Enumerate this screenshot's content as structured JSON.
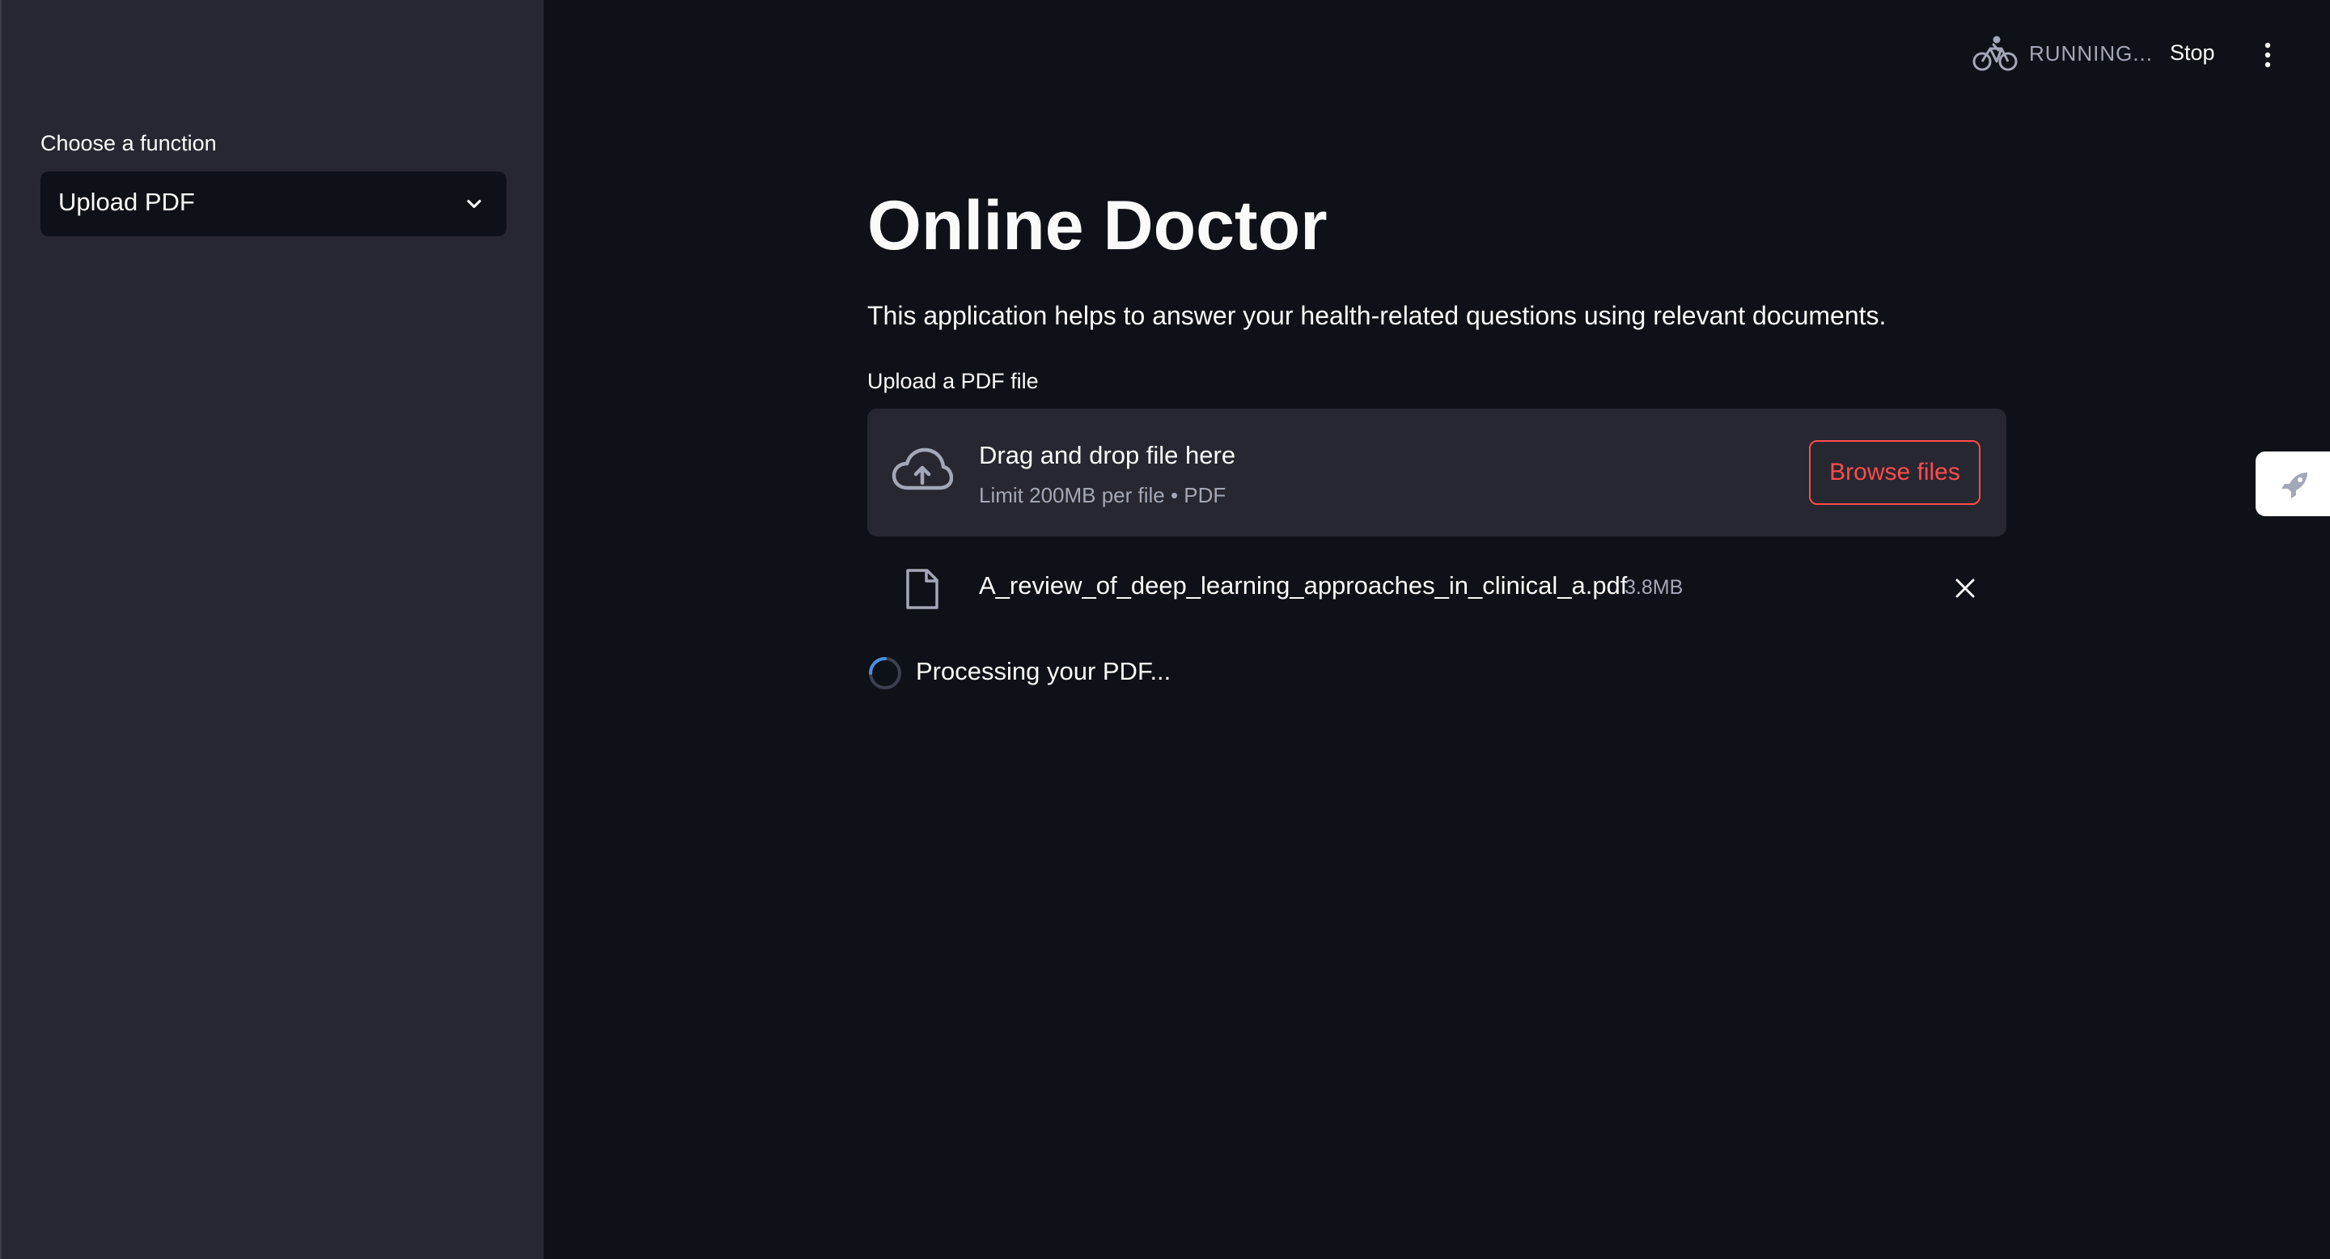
{
  "sidebar": {
    "select_label": "Choose a function",
    "select_value": "Upload PDF"
  },
  "header": {
    "status_text": "RUNNING...",
    "stop_label": "Stop",
    "status_icon": "bicycle-icon",
    "menu_icon": "kebab-menu-icon"
  },
  "main": {
    "title": "Online Doctor",
    "description": "This application helps to answer your health-related questions using relevant documents.",
    "uploader": {
      "label": "Upload a PDF file",
      "drop_title": "Drag and drop file here",
      "drop_limit": "Limit 200MB per file • PDF",
      "browse_label": "Browse files",
      "icon": "cloud-upload-icon"
    },
    "file": {
      "name": "A_review_of_deep_learning_approaches_in_clinical_a.pdf",
      "size": "3.8MB",
      "icon": "file-icon",
      "remove_icon": "close-icon"
    },
    "status": {
      "text": "Processing your PDF..."
    }
  },
  "colors": {
    "background": "#0e1117",
    "sidebar": "#262730",
    "accent": "#ff4b4b",
    "muted_text": "#a3a8b8",
    "text": "#fafafa"
  }
}
